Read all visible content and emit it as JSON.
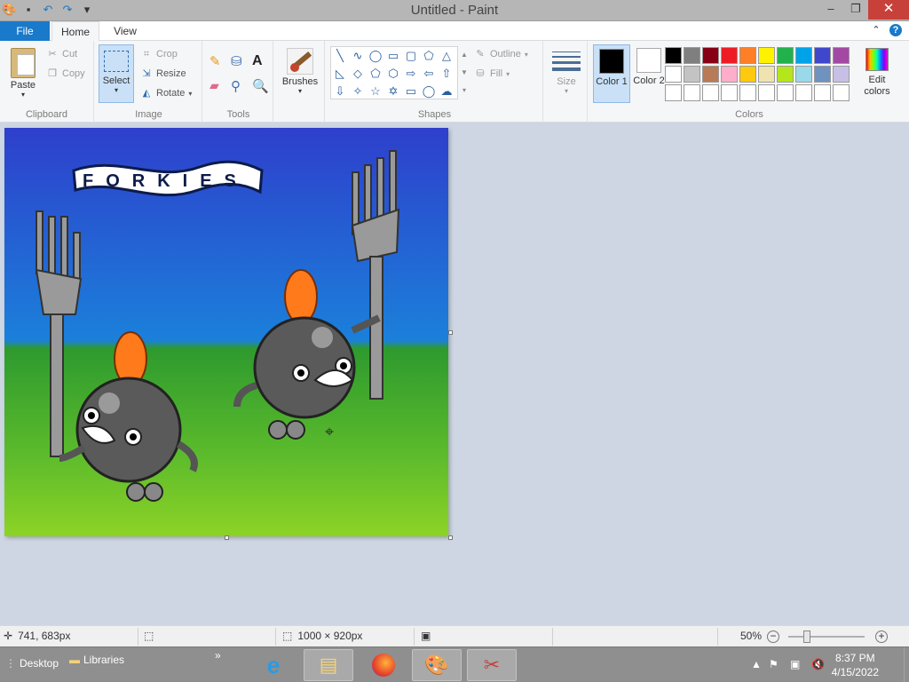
{
  "window": {
    "title": "Untitled - Paint",
    "minimize": "–",
    "maximize": "❐",
    "close": "✕"
  },
  "qat": {
    "icons": [
      "paint-app-icon",
      "save-icon",
      "undo-icon",
      "redo-icon"
    ],
    "dropdown": "▾"
  },
  "tabs": {
    "file": "File",
    "home": "Home",
    "view": "View"
  },
  "ribbon": {
    "clipboard": {
      "paste": "Paste",
      "cut": "Cut",
      "copy": "Copy",
      "label": "Clipboard"
    },
    "image": {
      "select": "Select",
      "crop": "Crop",
      "resize": "Resize",
      "rotate": "Rotate",
      "label": "Image"
    },
    "tools": {
      "label": "Tools"
    },
    "brushes": {
      "label": "Brushes"
    },
    "shapes": {
      "outline": "Outline",
      "fill": "Fill",
      "label": "Shapes"
    },
    "size": {
      "label": "Size"
    },
    "colors": {
      "color1_label": "Color 1",
      "color2_label": "Color 2",
      "color1": "#000000",
      "color2": "#ffffff",
      "edit": "Edit colors",
      "label": "Colors",
      "palette": [
        "#000000",
        "#7f7f7f",
        "#880015",
        "#ed1c24",
        "#ff7f27",
        "#fff200",
        "#22b14c",
        "#00a2e8",
        "#3f48cc",
        "#a349a4",
        "#ffffff",
        "#c3c3c3",
        "#b97a57",
        "#ffaec9",
        "#ffc90e",
        "#efe4b0",
        "#b5e61d",
        "#99d9ea",
        "#7092be",
        "#c8bfe7",
        "#ffffff",
        "#ffffff",
        "#ffffff",
        "#ffffff",
        "#ffffff",
        "#ffffff",
        "#ffffff",
        "#ffffff",
        "#ffffff",
        "#ffffff"
      ]
    }
  },
  "canvas": {
    "banner_text": "FORKIES"
  },
  "status": {
    "cursor_pos": "741, 683px",
    "image_size": "1000 × 920px",
    "zoom": "50%"
  },
  "taskbar": {
    "desktop": "Desktop",
    "libraries": "Libraries",
    "time": "8:37 PM",
    "date": "4/15/2022"
  }
}
